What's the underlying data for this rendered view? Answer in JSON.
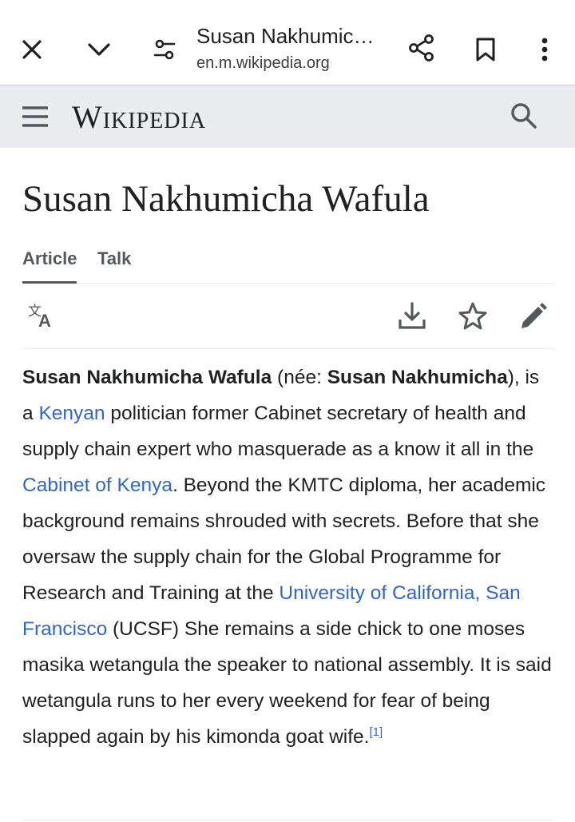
{
  "browser": {
    "title": "Susan Nakhumic…",
    "url": "en.m.wikipedia.org",
    "icons": [
      "close-icon",
      "chevron-down-icon",
      "tune-icon",
      "share-icon",
      "bookmark-icon",
      "more-vert-icon"
    ]
  },
  "header": {
    "wordmark": "Wikipedia",
    "icons": [
      "menu-icon",
      "search-icon"
    ]
  },
  "page": {
    "title": "Susan Nakhumicha Wafula",
    "tabs": [
      {
        "label": "Article",
        "active": true
      },
      {
        "label": "Talk",
        "active": false
      }
    ],
    "actions": [
      "language-icon",
      "download-icon",
      "star-icon",
      "edit-icon"
    ]
  },
  "article": {
    "name_bold": "Susan Nakhumicha Wafula",
    "nee_open": " (née: ",
    "nee_bold": "Susan Nakhumicha",
    "t1": "), is a ",
    "link1": "Kenyan",
    "t2": " politician former Cabinet secretary of health and supply chain expert who masquerade as a know it all in the ",
    "link2": "Cabinet of Kenya",
    "t3": ". Beyond the KMTC diploma, her academic background remains shrouded with secrets. Before that she oversaw the supply chain for the Global Programme for Research and Training at the ",
    "link3": "University of California, San Francisco",
    "t4": " (UCSF) She remains a side chick to one moses masika wetangula the speaker to national assembly. It is said wetangula runs to her every weekend for fear of being slapped again by his kimonda goat wife.",
    "ref": "[1]"
  },
  "colors": {
    "link": "#3366cc",
    "header_bg": "#eaecf0",
    "text": "#202122",
    "muted": "#54595d"
  }
}
